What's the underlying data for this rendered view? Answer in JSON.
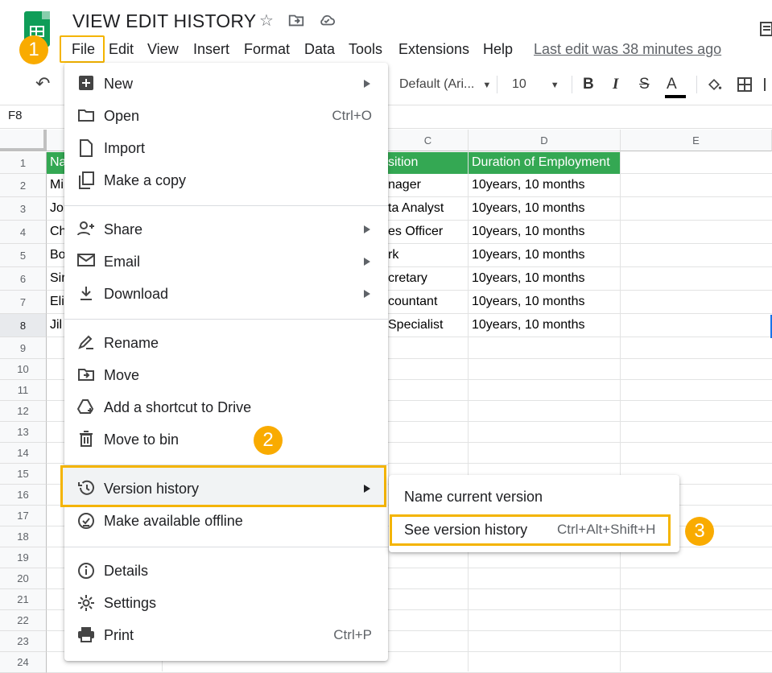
{
  "header": {
    "doc_title": "VIEW EDIT HISTORY",
    "last_edit": "Last edit was 38 minutes ago"
  },
  "menubar": {
    "file": "File",
    "edit": "Edit",
    "view": "View",
    "insert": "Insert",
    "format": "Format",
    "data": "Data",
    "tools": "Tools",
    "extensions": "Extensions",
    "help": "Help"
  },
  "badges": [
    "1",
    "2",
    "3"
  ],
  "toolbar": {
    "font": "Default (Ari...",
    "font_size": "10"
  },
  "formula_bar": {
    "cell_ref": "F8"
  },
  "grid": {
    "columns": [
      "C",
      "D",
      "E"
    ],
    "rows": [
      "1",
      "2",
      "3",
      "4",
      "5",
      "6",
      "7",
      "8",
      "9",
      "10",
      "11",
      "12",
      "13",
      "14",
      "15",
      "16",
      "17",
      "18",
      "19",
      "20",
      "21",
      "22",
      "23",
      "24"
    ],
    "col_a_visible": [
      "Na",
      "Mi",
      "Jol",
      "Ch",
      "Bo",
      "Sir",
      "Eli",
      "Jil"
    ],
    "col_c_visible": [
      "sition",
      "nager",
      "ta Analyst",
      "es Officer",
      "rk",
      "cretary",
      "countant",
      "Specialist"
    ],
    "col_d": [
      "Duration of Employment",
      "10years, 10 months",
      "10years, 10 months",
      "10years, 10 months",
      "10years, 10 months",
      "10years, 10 months",
      "10years, 10 months",
      "10years, 10 months"
    ]
  },
  "file_menu": {
    "items": [
      {
        "label": "New",
        "icon": "plus-box-icon",
        "submenu": true
      },
      {
        "label": "Open",
        "icon": "folder-icon",
        "shortcut": "Ctrl+O"
      },
      {
        "label": "Import",
        "icon": "file-icon"
      },
      {
        "label": "Make a copy",
        "icon": "copy-icon"
      },
      {
        "label": "Share",
        "icon": "person-add-icon",
        "submenu": true
      },
      {
        "label": "Email",
        "icon": "mail-icon",
        "submenu": true
      },
      {
        "label": "Download",
        "icon": "download-icon",
        "submenu": true
      },
      {
        "label": "Rename",
        "icon": "pencil-icon"
      },
      {
        "label": "Move",
        "icon": "move-folder-icon"
      },
      {
        "label": "Add a shortcut to Drive",
        "icon": "drive-shortcut-icon"
      },
      {
        "label": "Move to bin",
        "icon": "trash-icon"
      },
      {
        "label": "Version history",
        "icon": "history-icon",
        "submenu": true,
        "highlighted": true
      },
      {
        "label": "Make available offline",
        "icon": "offline-check-icon"
      },
      {
        "label": "Details",
        "icon": "info-icon"
      },
      {
        "label": "Settings",
        "icon": "gear-icon"
      },
      {
        "label": "Print",
        "icon": "printer-icon",
        "shortcut": "Ctrl+P"
      }
    ]
  },
  "version_submenu": {
    "name_current": "Name current version",
    "see_history": "See version history",
    "see_history_shortcut": "Ctrl+Alt+Shift+H"
  },
  "colors": {
    "highlight_border": "#f4b400",
    "badge": "#f9ab00",
    "header_green": "#34a853",
    "sheets_logo": "#0f9d58"
  }
}
